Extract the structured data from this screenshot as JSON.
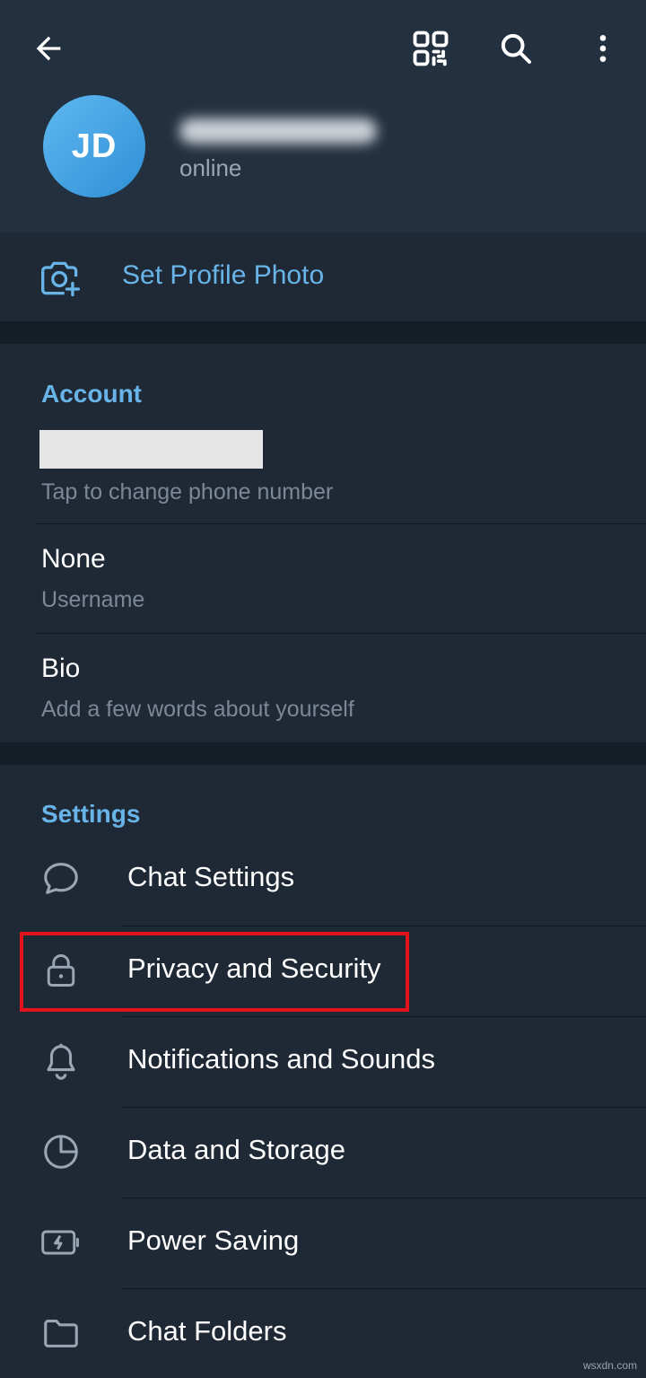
{
  "profile": {
    "avatar_initials": "JD",
    "status": "online"
  },
  "actions": {
    "set_profile_photo": "Set Profile Photo"
  },
  "account": {
    "title": "Account",
    "phone_hint": "Tap to change phone number",
    "username_value": "None",
    "username_label": "Username",
    "bio_value": "Bio",
    "bio_hint": "Add a few words about yourself"
  },
  "settings": {
    "title": "Settings",
    "items": [
      {
        "label": "Chat Settings",
        "icon": "chat-bubble-icon"
      },
      {
        "label": "Privacy and Security",
        "icon": "lock-icon"
      },
      {
        "label": "Notifications and Sounds",
        "icon": "bell-icon"
      },
      {
        "label": "Data and Storage",
        "icon": "pie-chart-icon"
      },
      {
        "label": "Power Saving",
        "icon": "battery-bolt-icon"
      },
      {
        "label": "Chat Folders",
        "icon": "folder-icon"
      }
    ]
  },
  "colors": {
    "accent": "#68b4e8",
    "highlight": "#e3121b",
    "background": "#1f2936",
    "header": "#233040"
  },
  "watermark": "wsxdn.com"
}
